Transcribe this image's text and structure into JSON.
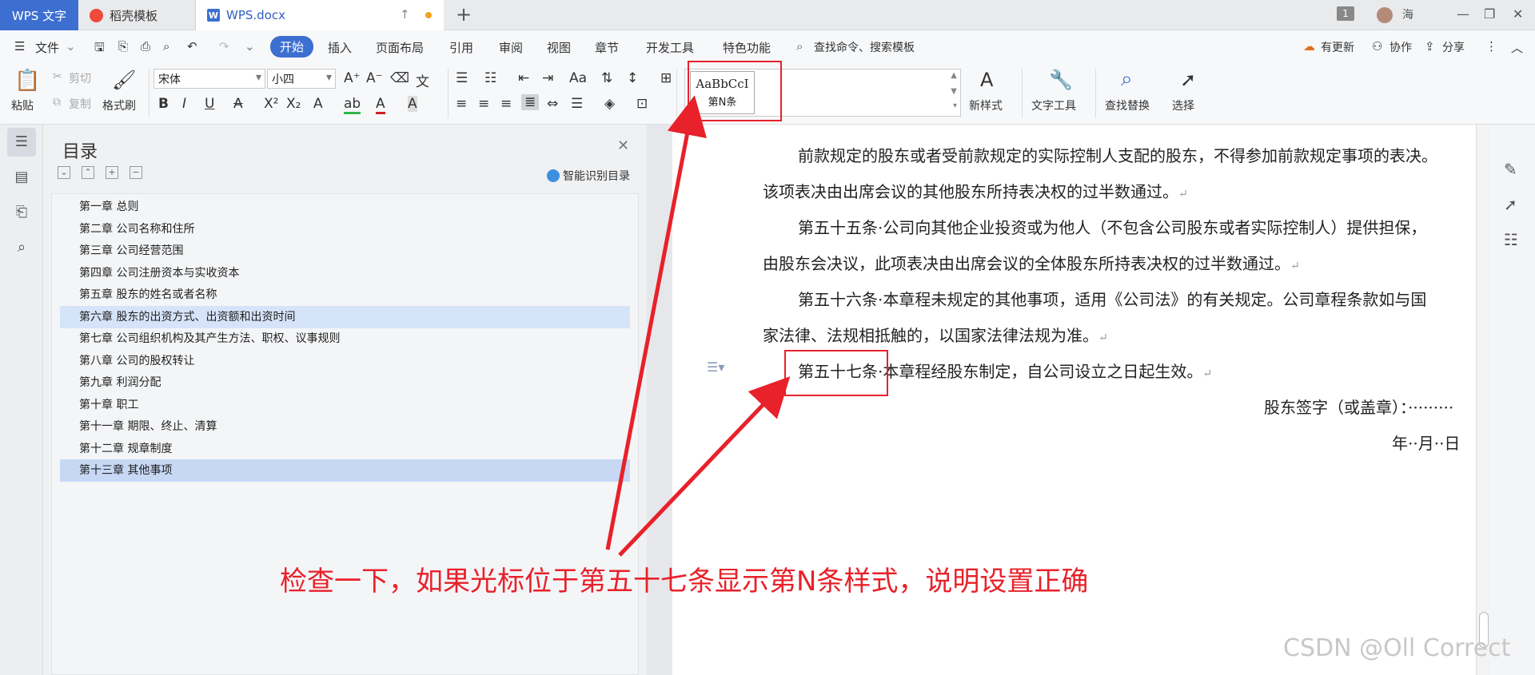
{
  "titlebar": {
    "app_tab": "WPS 文字",
    "template_tab": "稻壳模板",
    "doc_tab": "WPS.docx",
    "doc_icon_letter": "W",
    "page_badge": "1",
    "user_name": "海"
  },
  "menu": {
    "file": "文件",
    "tabs": [
      "开始",
      "插入",
      "页面布局",
      "引用",
      "审阅",
      "视图",
      "章节",
      "开发工具",
      "特色功能"
    ],
    "search": "查找命令、搜索模板",
    "update": "有更新",
    "collab": "协作",
    "share": "分享"
  },
  "toolbar": {
    "paste": "粘贴",
    "cut": "剪切",
    "copy": "复制",
    "format_painter": "格式刷",
    "font_name": "宋体",
    "font_size": "小四",
    "style_preview": "AaBbCcI",
    "style_name": "第N条",
    "new_style": "新样式",
    "text_tools": "文字工具",
    "find_replace": "查找替换",
    "select": "选择"
  },
  "nav": {
    "title": "目录",
    "smart_toc": "智能识别目录",
    "items": [
      "第一章  总则",
      "第二章  公司名称和住所",
      "第三章  公司经营范围",
      "第四章  公司注册资本与实收资本",
      "第五章  股东的姓名或者名称",
      "第六章  股东的出资方式、出资额和出资时间",
      "第七章  公司组织机构及其产生方法、职权、议事规则",
      "第八章  公司的股权转让",
      "第九章  利润分配",
      "第十章  职工",
      "第十一章  期限、终止、清算",
      "第十二章  规章制度",
      "第十三章  其他事项"
    ]
  },
  "document": {
    "lines": [
      "前款规定的股东或者受前款规定的实际控制人支配的股东，不得参加前款规定事项的表决。",
      "该项表决由出席会议的其他股东所持表决权的过半数通过。",
      "第五十五条·公司向其他企业投资或为他人（不包含公司股东或者实际控制人）提供担保，",
      "由股东会决议，此项表决由出席会议的全体股东所持表决权的过半数通过。",
      "第五十六条·本章程未规定的其他事项，适用《公司法》的有关规定。公司章程条款如与国",
      "家法律、法规相抵触的，以国家法律法规为准。",
      "第五十七条·本章程经股东制定，自公司设立之日起生效。",
      "股东签字（或盖章）：·········",
      "年··月··日"
    ],
    "para_mark": "↵"
  },
  "annotation": {
    "text": "检查一下，如果光标位于第五十七条显示第N条样式，说明设置正确",
    "color": "#e8212a"
  },
  "watermark": "CSDN @Oll Correct",
  "colors": {
    "accent": "#3d6fd1",
    "annotation_red": "#e8212a",
    "toc_highlight": "#c6d8f4"
  }
}
